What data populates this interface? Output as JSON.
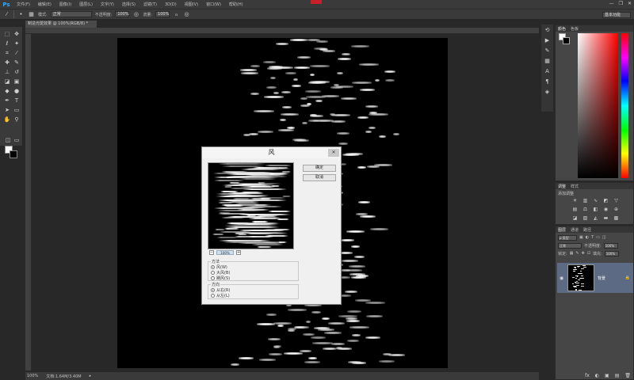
{
  "app": {
    "logo": "Ps",
    "workspace": "基本功能"
  },
  "menu": [
    "文件(F)",
    "编辑(E)",
    "图像(I)",
    "图层(L)",
    "文字(Y)",
    "选择(S)",
    "滤镜(T)",
    "3D(D)",
    "视图(V)",
    "窗口(W)",
    "帮助(H)"
  ],
  "window_controls": {
    "minimize": "—",
    "restore": "❐",
    "close": "✕"
  },
  "options": {
    "mode_label": "模式:",
    "mode_value": "正常",
    "opacity_label": "不透明度:",
    "opacity_value": "100%",
    "flow_label": "流量:",
    "flow_value": "100%"
  },
  "document": {
    "tab": "制造光斑效果 @ 100%(RGB/8) *"
  },
  "status": {
    "zoom": "100%",
    "doc": "文档:1.64M/3.40M"
  },
  "dialog": {
    "title": "风",
    "close": "✕",
    "ok": "确定",
    "cancel": "取消",
    "zoom": "100%",
    "method_label": "方法",
    "methods": [
      "风(W)",
      "大风(B)",
      "飓风(S)"
    ],
    "direction_label": "方向",
    "directions": [
      "从右(R)",
      "从左(L)"
    ]
  },
  "panels": {
    "color_tabs": [
      "颜色",
      "色板"
    ],
    "adjust_tabs": [
      "调整",
      "样式"
    ],
    "adjust_title": "添加调整",
    "layers_tabs": [
      "图层",
      "通道",
      "路径"
    ],
    "kind": "ρ 类型",
    "blend": "正常",
    "opacity_label": "不透明度:",
    "opacity_value": "100%",
    "lock_label": "锁定:",
    "fill_label": "填充:",
    "fill_value": "100%",
    "layer_name": "背景",
    "lock_icon": "🔒",
    "footer": [
      "fx",
      "◐",
      "▣",
      "▤",
      "🗑"
    ]
  }
}
